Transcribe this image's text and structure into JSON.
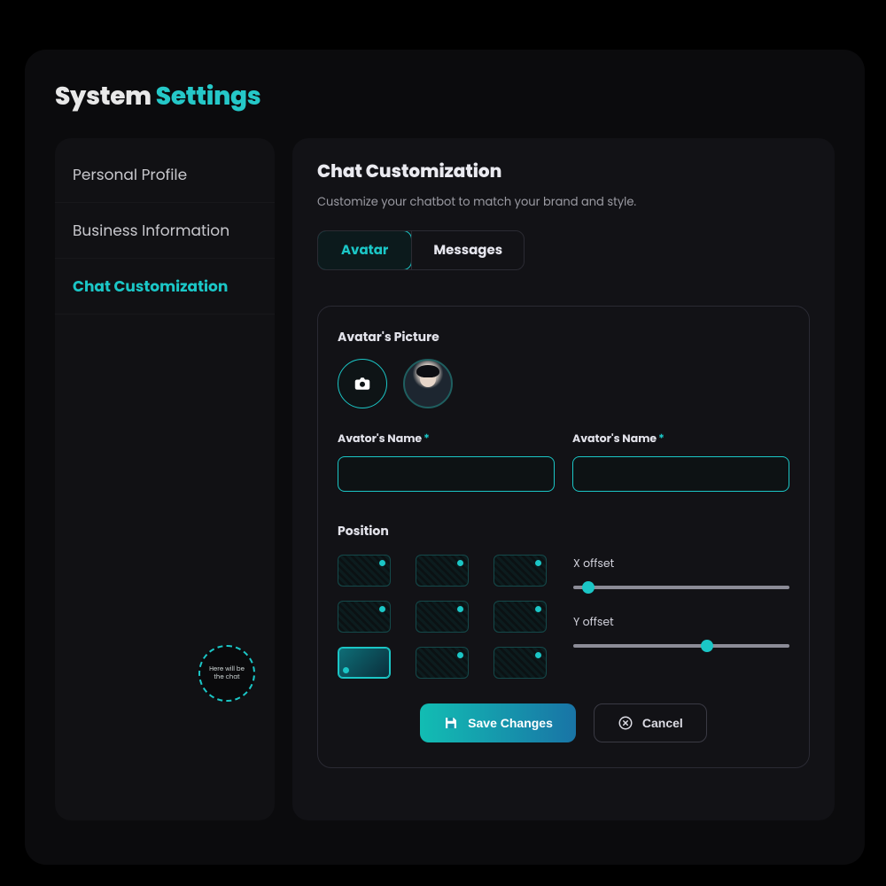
{
  "header": {
    "title_a": "System ",
    "title_b": "Settings"
  },
  "sidebar": {
    "items": [
      {
        "label": "Personal Profile",
        "active": false
      },
      {
        "label": "Business Information",
        "active": false
      },
      {
        "label": "Chat Customization",
        "active": true
      }
    ],
    "chat_placeholder": "Here will be the chat"
  },
  "main": {
    "title": "Chat  Customization",
    "subtitle": "Customize your chatbot to match your brand and style.",
    "tabs": [
      {
        "label": "Avatar",
        "active": true
      },
      {
        "label": "Messages",
        "active": false
      }
    ]
  },
  "avatar_section": {
    "picture_label": "Avatar's Picture",
    "upload_icon": "camera-icon",
    "name_field_1": {
      "label": "Avator's Name",
      "required": "*",
      "value": ""
    },
    "name_field_2": {
      "label": "Avator's Name",
      "required": "*",
      "value": ""
    },
    "position_label": "Position",
    "selected_position_index": 6,
    "sliders": {
      "x": {
        "label": "X offset",
        "percent": 7
      },
      "y": {
        "label": "Y offset",
        "percent": 62
      }
    }
  },
  "actions": {
    "save": "Save Changes",
    "cancel": "Cancel"
  }
}
